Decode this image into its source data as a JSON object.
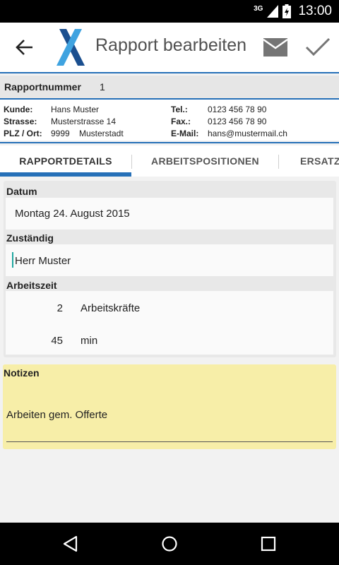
{
  "status_bar": {
    "network": "3G",
    "time": "13:00"
  },
  "action_bar": {
    "title": "Rapport bearbeiten",
    "icons": [
      "back-arrow-icon",
      "app-logo",
      "mail-icon",
      "check-icon"
    ]
  },
  "report": {
    "number_label": "Rapportnummer",
    "number_value": "1"
  },
  "customer": {
    "kunde_label": "Kunde:",
    "kunde_value": "Hans Muster",
    "strasse_label": "Strasse:",
    "strasse_value": "Musterstrasse 14",
    "plz_label": "PLZ / Ort:",
    "plz_value": "9999",
    "ort_value": "Musterstadt",
    "tel_label": "Tel.:",
    "tel_value": "0123 456 78 90",
    "fax_label": "Fax.:",
    "fax_value": "0123 456 78 90",
    "email_label": "E-Mail:",
    "email_value": "hans@mustermail.ch"
  },
  "tabs": [
    {
      "label": "RAPPORTDETAILS",
      "active": true
    },
    {
      "label": "ARBEITSPOSITIONEN",
      "active": false
    },
    {
      "label": "ERSATZ",
      "active": false
    }
  ],
  "details": {
    "datum_label": "Datum",
    "datum_value": "Montag 24. August 2015",
    "zustaendig_label": "Zuständig",
    "zustaendig_value": "Herr Muster",
    "arbeitszeit_label": "Arbeitszeit",
    "arbeitskraefte_value": "2",
    "arbeitskraefte_unit": "Arbeitskräfte",
    "minutes_value": "45",
    "minutes_unit": "min"
  },
  "notes": {
    "label": "Notizen",
    "text": "Arbeiten gem. Offerte"
  },
  "colors": {
    "accent": "#2670b8",
    "notes_background": "#f7eea8",
    "logo_dark": "#1b4f8f",
    "logo_light": "#3fa3e0"
  }
}
